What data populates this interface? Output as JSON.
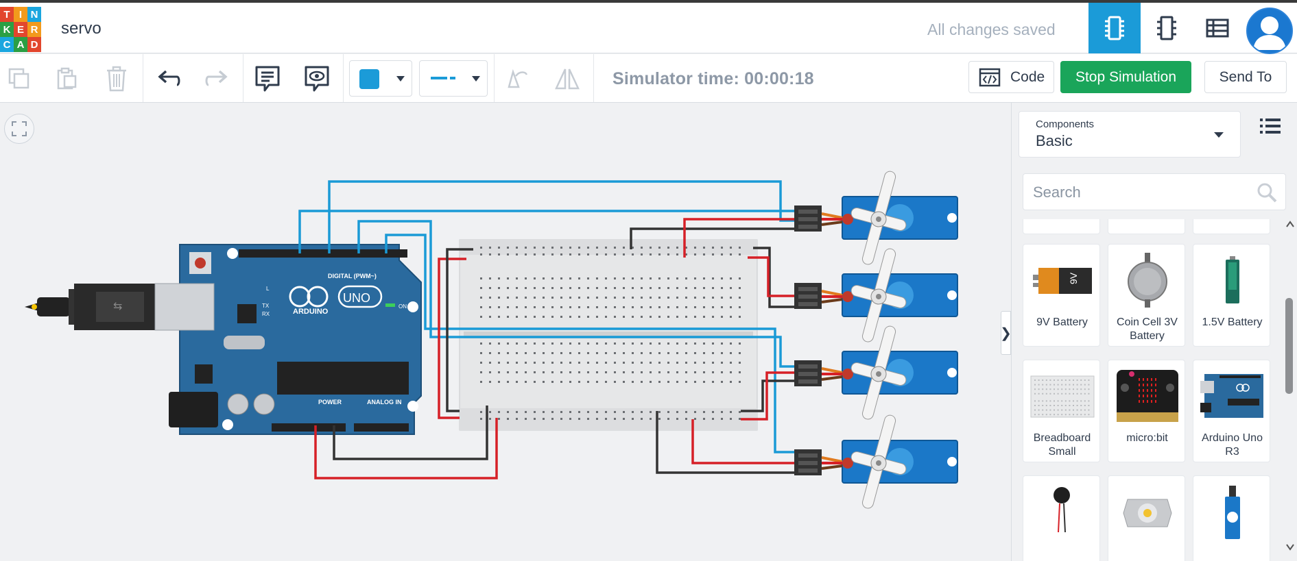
{
  "app": {
    "logo_letters": [
      "T",
      "I",
      "N",
      "K",
      "E",
      "R",
      "C",
      "A",
      "D"
    ],
    "logo_colors": [
      "#e2462d",
      "#f29a1c",
      "#1aa6df",
      "#2b9f44",
      "#e2462d",
      "#f29a1c",
      "#1aa6df",
      "#2b9f44",
      "#e2462d"
    ],
    "title": "servo",
    "save_status": "All changes saved"
  },
  "header": {
    "views": [
      {
        "icon": "circuit-view-icon",
        "active": true
      },
      {
        "icon": "schematic-view-icon",
        "active": false
      },
      {
        "icon": "component-list-icon",
        "active": false
      }
    ],
    "avatar_icon": "user-avatar-icon"
  },
  "toolbar": {
    "tools": [
      "copy-icon",
      "paste-icon",
      "delete-icon",
      "undo-icon",
      "redo-icon",
      "notes-icon",
      "notes-visibility-icon"
    ],
    "fill_color": "#1b9bd8",
    "simulator_time": "Simulator time: 00:00:18",
    "code_label": "Code",
    "stop_label": "Stop Simulation",
    "send_label": "Send To"
  },
  "panel": {
    "components_label": "Components",
    "components_value": "Basic",
    "search_placeholder": "Search",
    "items": [
      {
        "name": "9V Battery",
        "icon": "battery-9v-icon"
      },
      {
        "name": "Coin Cell 3V Battery",
        "icon": "coin-cell-icon"
      },
      {
        "name": "1.5V Battery",
        "icon": "battery-aa-icon"
      },
      {
        "name": "Breadboard Small",
        "icon": "breadboard-icon"
      },
      {
        "name": "micro:bit",
        "icon": "microbit-icon"
      },
      {
        "name": "Arduino Uno R3",
        "icon": "arduino-icon"
      },
      {
        "name": "",
        "icon": "vibration-motor-icon"
      },
      {
        "name": "",
        "icon": "dc-motor-icon"
      },
      {
        "name": "",
        "icon": "servo-icon"
      }
    ]
  },
  "circuit": {
    "board_labels": {
      "brand": "ARDUINO",
      "model": "UNO",
      "digital": "DIGITAL (PWM~)",
      "power": "POWER",
      "analog": "ANALOG IN",
      "on": "ON",
      "tx": "TX",
      "rx": "RX",
      "l": "L"
    },
    "wire_colors": {
      "signal": "#1a9ad6",
      "power": "#d62027",
      "ground": "#333333"
    }
  }
}
